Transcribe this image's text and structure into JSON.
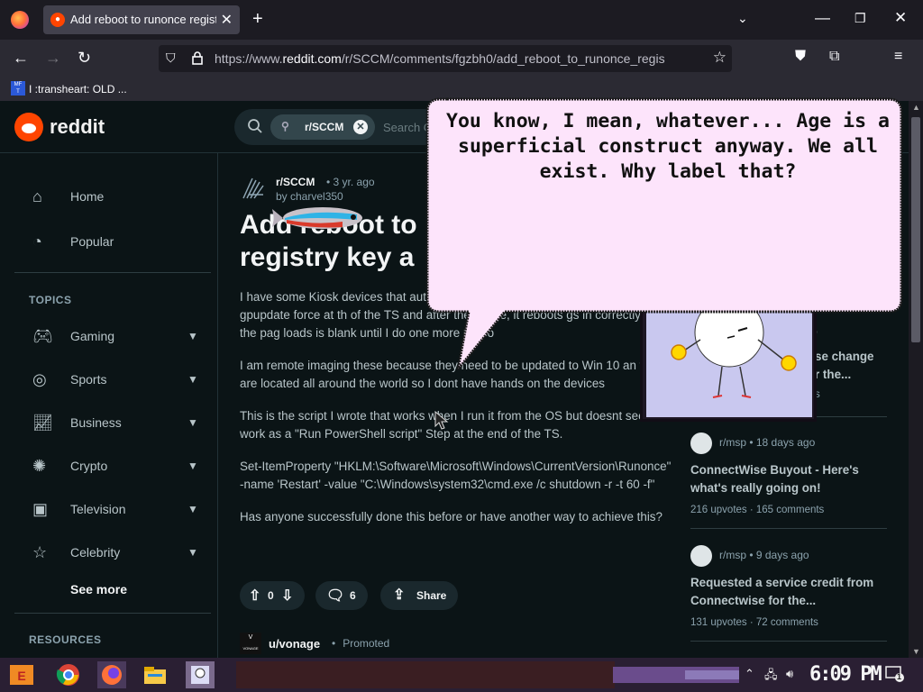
{
  "browser": {
    "tab_title": "Add reboot to runonce regist",
    "url_prefix": "https://www.",
    "url_domain": "reddit.com",
    "url_path": "/r/SCCM/comments/fgzbh0/add_reboot_to_runonce_regis",
    "bookmark_label": "I :transheart: OLD ..."
  },
  "reddit": {
    "wordmark": "reddit",
    "search_community": "r/SCCM",
    "search_placeholder": "Search C"
  },
  "sidebar": {
    "home": "Home",
    "popular": "Popular",
    "topics_heading": "TOPICS",
    "topics": [
      "Gaming",
      "Sports",
      "Business",
      "Crypto",
      "Television",
      "Celebrity"
    ],
    "see_more": "See more",
    "resources_heading": "RESOURCES"
  },
  "post": {
    "subreddit": "r/SCCM",
    "age": "• 3 yr. ago",
    "author": "by charvel350",
    "title_line1": "Add reboot to",
    "title_line2": "registry key a",
    "body_p1": "I have some Kiosk devices that aut page. I was able to make a step to succ a gpupdate force at th of the TS and after the image, it reboots gs in correctly, but the pag loads is blank until I do one more reboo",
    "body_p2": "I am remote imaging these because they need to be updated to Win 10 an they are located all around the world so I dont have hands on the devices",
    "body_p3": "This is the script I wrote that works when I run it from the OS but doesnt seem to work as a \"Run PowerShell script\" Step at the end of the TS.",
    "body_p4": "Set-ItemProperty \"HKLM:\\Software\\Microsoft\\Windows\\CurrentVersion\\Runonce\" -name 'Restart' -value \"C:\\Windows\\system32\\cmd.exe /c shutdown -r -t 60 -f\"",
    "body_p5": "Has anyone successfully done this before or have another way to achieve this?",
    "votes": "0",
    "comments": "6",
    "share": "Share",
    "promo_user": "u/vonage",
    "promo_tag": "Promoted",
    "promo_logo": "VONAGE"
  },
  "right_column": {
    "partial_1": "se change",
    "partial_2": "r the...",
    "partial_3": "s",
    "partial_4": "o",
    "cards": [
      {
        "meta": "r/msp • 18 days ago",
        "title": "ConnectWise Buyout - Here's what's really going on!",
        "stats": "216 upvotes · 165 comments"
      },
      {
        "meta": "r/msp • 9 days ago",
        "title": "Requested a service credit from Connectwise for the...",
        "stats": "131 upvotes · 72 comments"
      }
    ]
  },
  "bubble": {
    "text": "You know, I mean, whatever... Age is a superficial construct anyway. We all exist. Why label that?"
  },
  "taskbar": {
    "clock": "6:09 PM",
    "notification_count": "1"
  }
}
